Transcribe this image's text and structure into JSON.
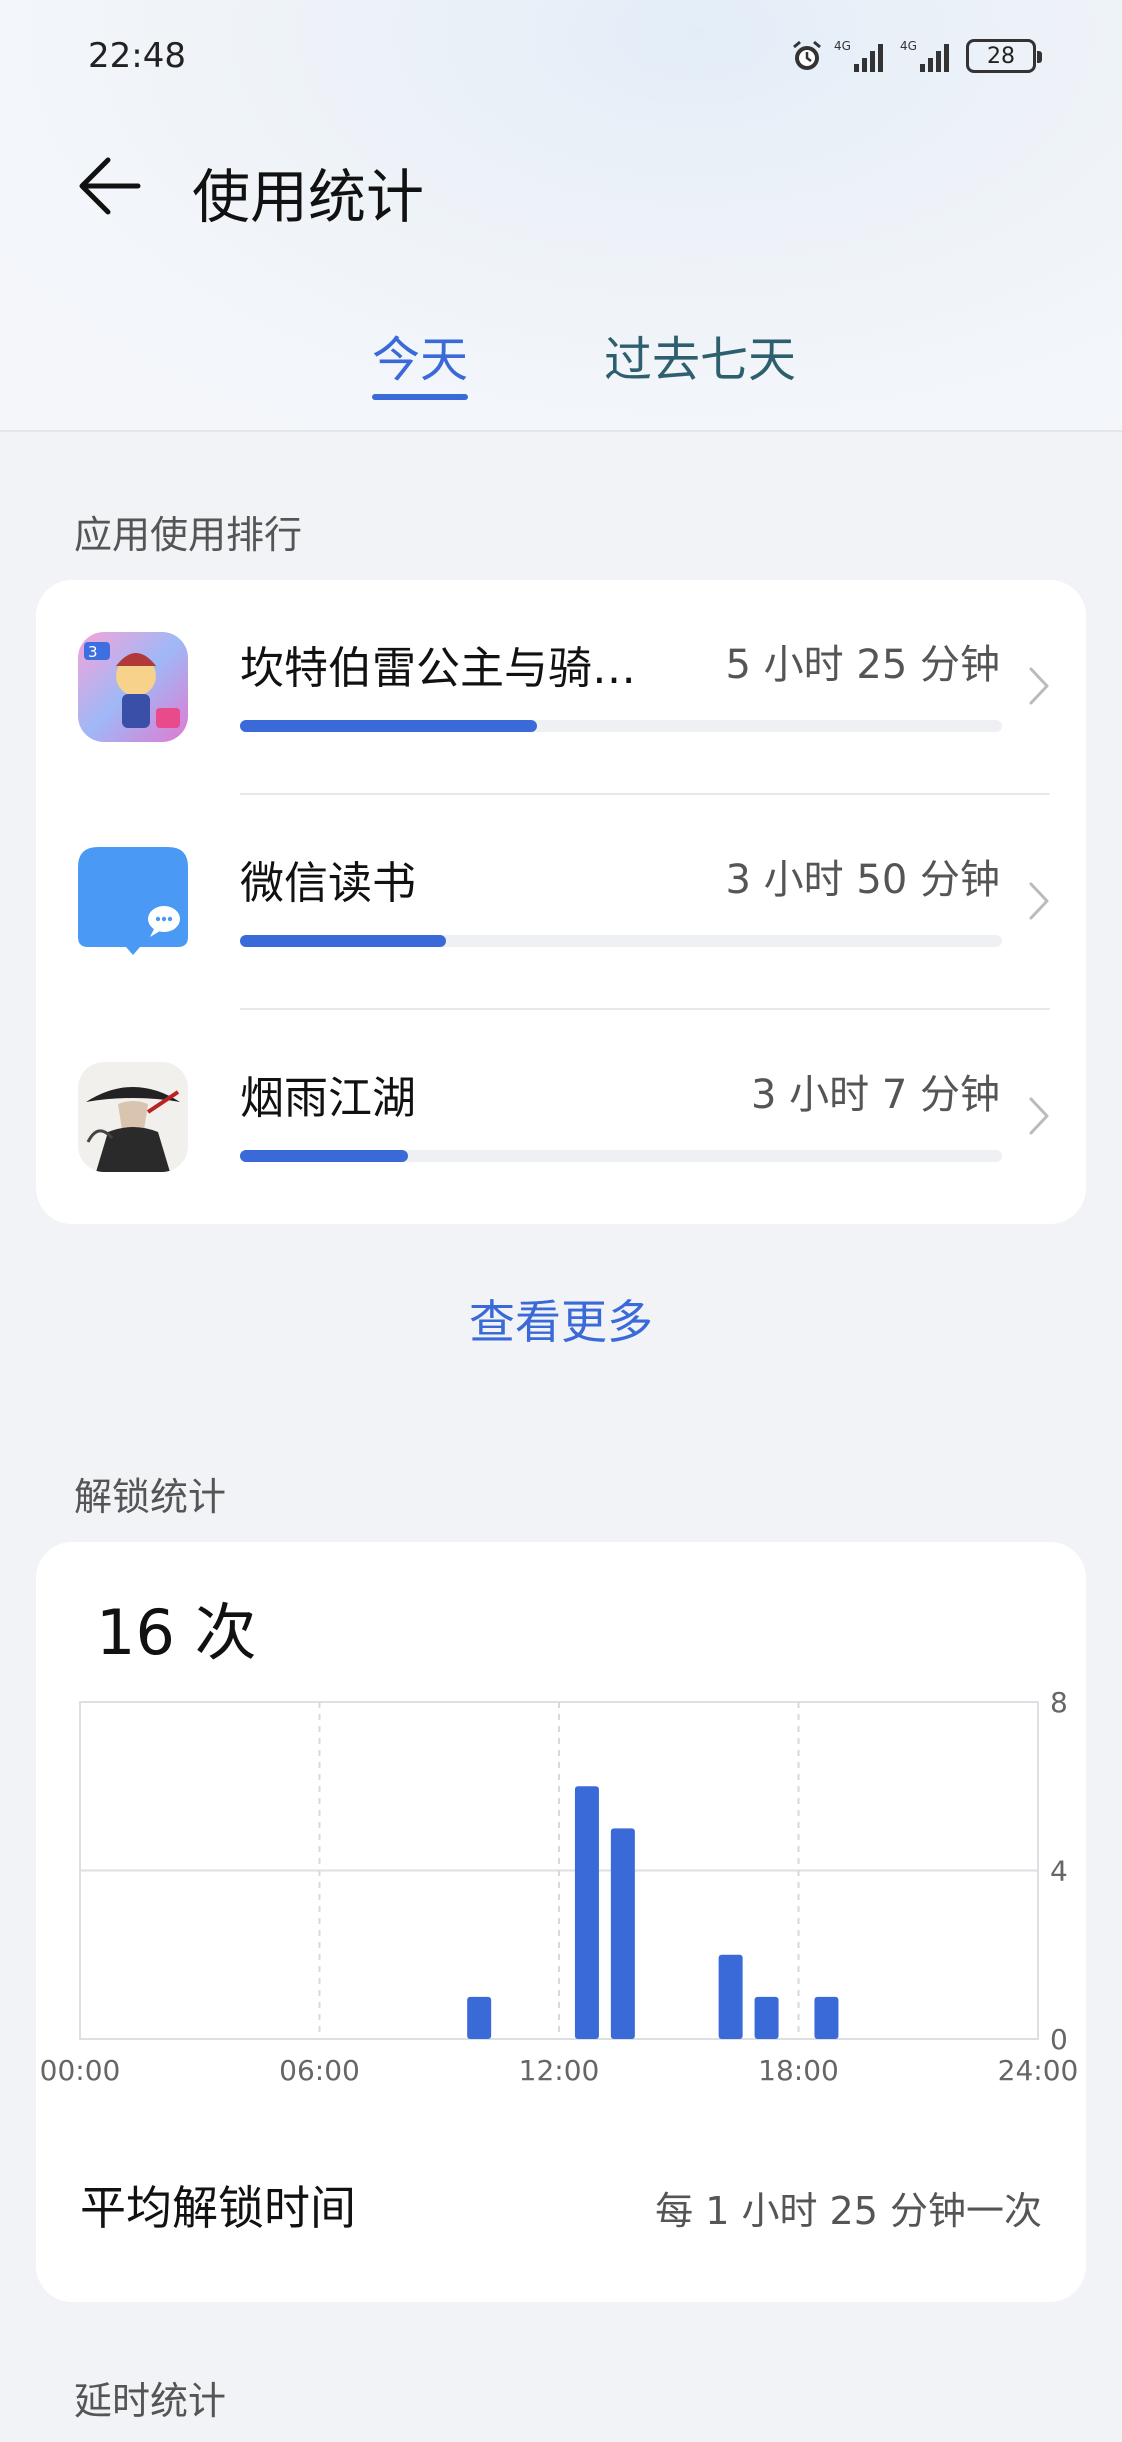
{
  "status_bar": {
    "time": "22:48",
    "battery": "28",
    "icons": [
      "alarm-icon",
      "signal-4g-icon",
      "signal-4g-icon",
      "battery-icon"
    ]
  },
  "header": {
    "title": "使用统计",
    "back_icon": "arrow-left-icon"
  },
  "tabs": [
    {
      "label": "今天",
      "active": true
    },
    {
      "label": "过去七天",
      "active": false
    }
  ],
  "app_ranking": {
    "section_title": "应用使用排行",
    "items": [
      {
        "name": "坎特伯雷公主与骑…",
        "time": "5 小时 25 分钟",
        "progress": 0.39
      },
      {
        "name": "微信读书",
        "time": "3 小时 50 分钟",
        "progress": 0.27
      },
      {
        "name": "烟雨江湖",
        "time": "3 小时 7 分钟",
        "progress": 0.22
      }
    ],
    "see_more": "查看更多"
  },
  "unlock_stats": {
    "section_title": "解锁统计",
    "count": "16 次",
    "avg_label": "平均解锁时间",
    "avg_value": "每 1 小时 25 分钟一次"
  },
  "chart_data": {
    "type": "bar",
    "x_ticks": [
      "00:00",
      "06:00",
      "12:00",
      "18:00",
      "24:00"
    ],
    "y_ticks": [
      "8",
      "4",
      "0"
    ],
    "ylim": [
      0,
      8
    ],
    "xlim": [
      0,
      24
    ],
    "bars": [
      {
        "hour": 10,
        "value": 1
      },
      {
        "hour": 12.7,
        "value": 6
      },
      {
        "hour": 13.6,
        "value": 5
      },
      {
        "hour": 16.3,
        "value": 2
      },
      {
        "hour": 17.2,
        "value": 1
      },
      {
        "hour": 18.7,
        "value": 1
      }
    ],
    "color": "#3a6ad8"
  },
  "delay_stats": {
    "section_title": "延时统计"
  }
}
